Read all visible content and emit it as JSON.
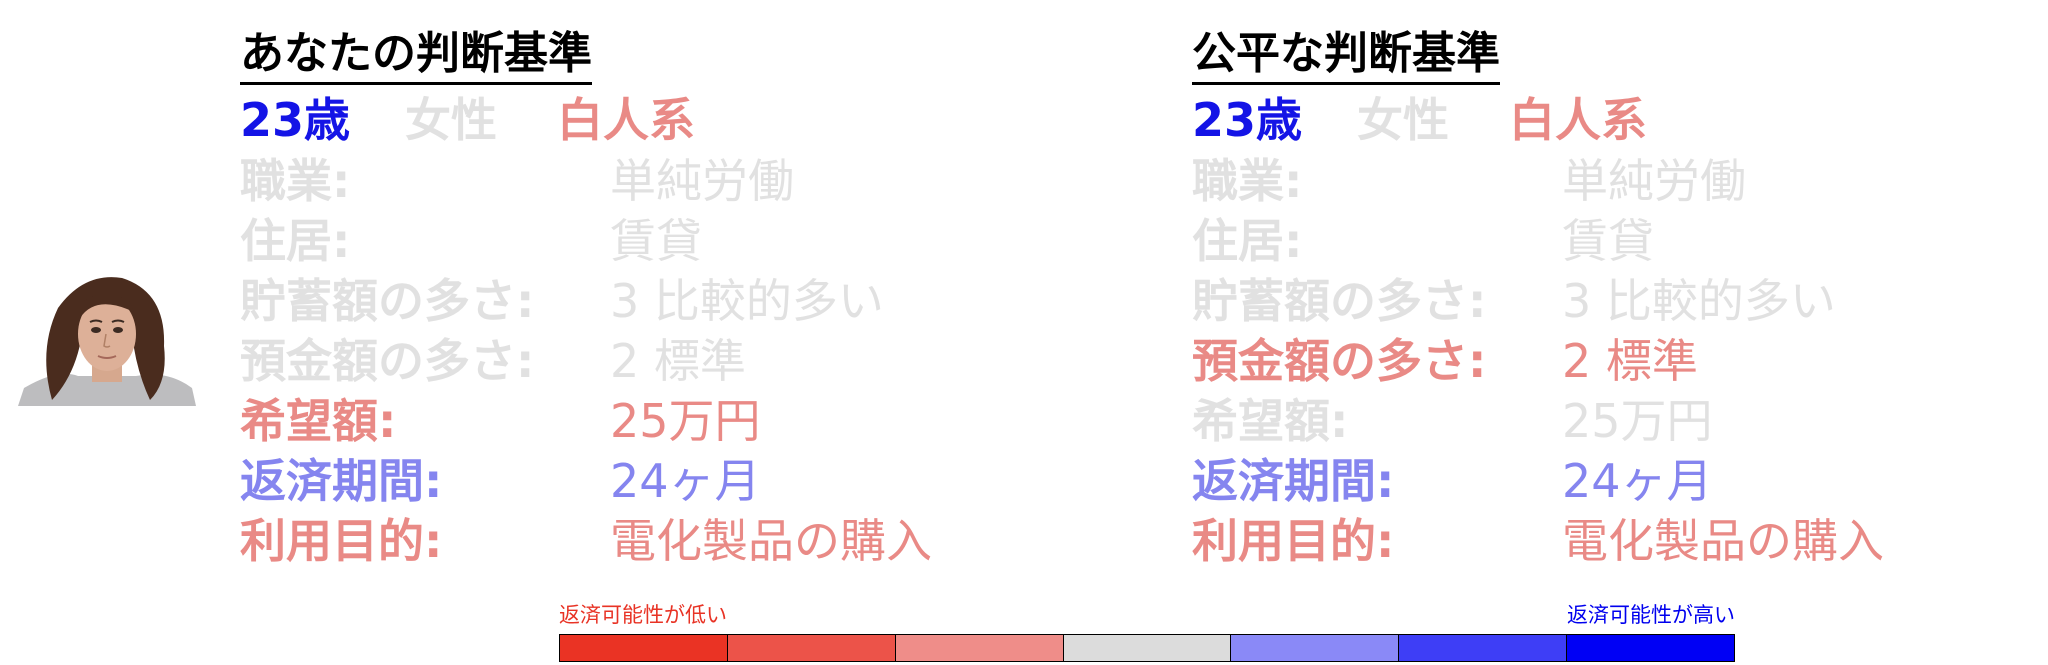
{
  "colors": {
    "gray": "#e1e1e1",
    "red": "#e98a86",
    "blue_med": "#8585ef",
    "blue_dark": "#1414e6",
    "title": "#000000"
  },
  "left": {
    "title": "あなたの判断基準",
    "age": "23歳",
    "gender": "女性",
    "race": "白人系",
    "rows": [
      {
        "label": "職業:",
        "value": "単純労働",
        "color": "#e1e1e1"
      },
      {
        "label": "住居:",
        "value": "賃貸",
        "color": "#e1e1e1"
      },
      {
        "label": "貯蓄額の多さ:",
        "value": "3 比較的多い",
        "color": "#e1e1e1"
      },
      {
        "label": "預金額の多さ:",
        "value": "2 標準",
        "color": "#e1e1e1"
      },
      {
        "label": "希望額:",
        "value": "25万円",
        "color": "#e98a86"
      },
      {
        "label": "返済期間:",
        "value": "24ヶ月",
        "color": "#8585ef"
      },
      {
        "label": "利用目的:",
        "value": "電化製品の購入",
        "color": "#e98a86"
      }
    ]
  },
  "right": {
    "title": "公平な判断基準",
    "age": "23歳",
    "gender": "女性",
    "race": "白人系",
    "rows": [
      {
        "label": "職業:",
        "value": "単純労働",
        "color": "#e1e1e1"
      },
      {
        "label": "住居:",
        "value": "賃貸",
        "color": "#e1e1e1"
      },
      {
        "label": "貯蓄額の多さ:",
        "value": "3 比較的多い",
        "color": "#e1e1e1"
      },
      {
        "label": "預金額の多さ:",
        "value": "2 標準",
        "color": "#e98a86"
      },
      {
        "label": "希望額:",
        "value": "25万円",
        "color": "#e1e1e1"
      },
      {
        "label": "返済期間:",
        "value": "24ヶ月",
        "color": "#8585ef"
      },
      {
        "label": "利用目的:",
        "value": "電化製品の購入",
        "color": "#e98a86"
      }
    ]
  },
  "legend": {
    "low_label": "返済可能性が低い",
    "high_label": "返済可能性が高い",
    "segments": [
      "#ea3324",
      "#ec5349",
      "#ef8d89",
      "#dcdcdc",
      "#8a89f7",
      "#3e3ef6",
      "#0000f5"
    ]
  }
}
